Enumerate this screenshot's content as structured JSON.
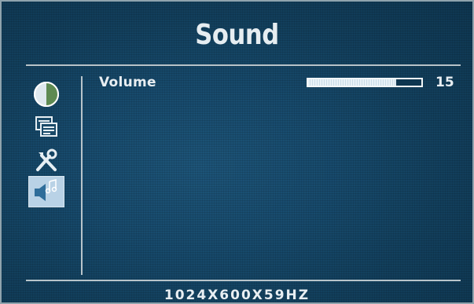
{
  "menu": {
    "title": "Sound",
    "icons": [
      {
        "name": "contrast-icon",
        "selected": false
      },
      {
        "name": "image-setup-icon",
        "selected": false
      },
      {
        "name": "tools-icon",
        "selected": false
      },
      {
        "name": "speaker-music-icon",
        "selected": true
      }
    ]
  },
  "settings": [
    {
      "label": "Volume",
      "value": "15",
      "level_fraction": 0.78
    }
  ],
  "footer": {
    "resolution": "1024X600X59HZ"
  },
  "colors": {
    "background": "#174a6c",
    "text": "#e8eef2",
    "rule": "#b8c4ca",
    "selected_icon_bg": "#b9d2e6",
    "bar_fill": "#e8f1f7"
  }
}
